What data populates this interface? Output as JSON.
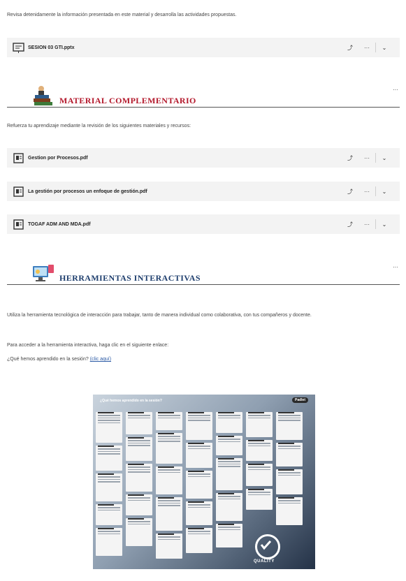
{
  "intro_text": "Revisa detenidamente la información presentada en este material y desarrolla las actividades propuestas.",
  "files_top": [
    {
      "name": "SESION 03 GTI.pptx",
      "icon": "presentation-icon"
    }
  ],
  "section1": {
    "title": "MATERIAL COMPLEMENTARIO",
    "title_color": "#b3182b",
    "more": "···",
    "subtitle": "Refuerza tu aprendizaje mediante la revisión de los siguientes materiales y recursos:",
    "files": [
      {
        "name": "Gestion por Procesos.pdf",
        "icon": "document-icon"
      },
      {
        "name": "La gestión por procesos un enfoque de gestión.pdf",
        "icon": "document-icon"
      },
      {
        "name": "TOGAF ADM AND MDA.pdf",
        "icon": "document-icon"
      }
    ]
  },
  "section2": {
    "title": "HERRAMIENTAS INTERACTIVAS",
    "title_color": "#1f3f6e",
    "more": "···",
    "paragraph1": "Utiliza la herramienta tecnológica de interacción para trabajar, tanto de manera individual como colaborativa, con tus compañeros y docente.",
    "paragraph2": "Para acceder a la herramienta interactiva, haga clic en el siguiente enlace:",
    "question_prefix": "¿Qué hemos aprendido en la sesión? ",
    "link_text": "(clic aquí)"
  },
  "row_actions": {
    "share": "⤴",
    "more": "···",
    "expand": "⌄"
  },
  "board": {
    "title": "¿Qué hemos aprendido en la sesión?",
    "badge": "Padlet",
    "quality_label": "QUALITY"
  }
}
